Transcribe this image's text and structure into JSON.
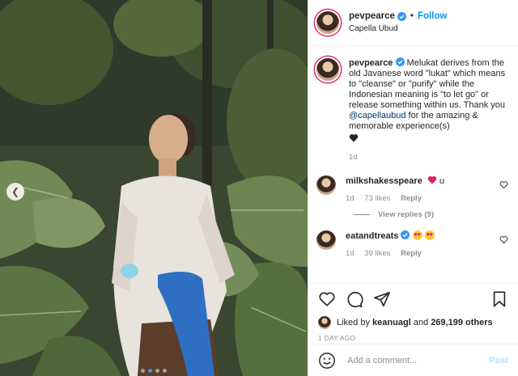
{
  "header": {
    "username": "pevpearce",
    "follow_label": "Follow",
    "bullet": "•",
    "location": "Capella Ubud"
  },
  "caption": {
    "username": "pevpearce",
    "text_before_mention": " Melukat derives from the old Javanese word \"lukat\" which means to \"cleanse\" or \"purify\" while the Indonesian meaning is \"to let go\" or release something within us. Thank you ",
    "mention": "@capellaubud",
    "text_after_mention": " for the amazing & memorable experience(s)",
    "age": "1d"
  },
  "comments": [
    {
      "username": "milkshakesspeare",
      "text": "u",
      "age": "1d",
      "likes": "73 likes",
      "reply_label": "Reply"
    },
    {
      "username": "eatandtreats",
      "age": "1d",
      "likes": "39 likes",
      "reply_label": "Reply"
    }
  ],
  "view_replies_label": "View replies (9)",
  "likes_summary": {
    "prefix": "Liked by ",
    "user": "keanuagl",
    "middle": " and ",
    "count": "269,199 others"
  },
  "timestamp": "1 DAY AGO",
  "add_comment": {
    "placeholder": "Add a comment...",
    "post_label": "Post"
  },
  "carousel": {
    "slides": 4,
    "active_index": 1
  },
  "colors": {
    "accent": "#0095f6",
    "like_red": "#ed4956",
    "muted": "#8e8e8e",
    "mention": "#00376b"
  },
  "icons": [
    "verified-badge-icon",
    "heart-icon",
    "comment-icon",
    "share-icon",
    "save-icon",
    "emoji-smile-icon",
    "chevron-left-icon"
  ]
}
